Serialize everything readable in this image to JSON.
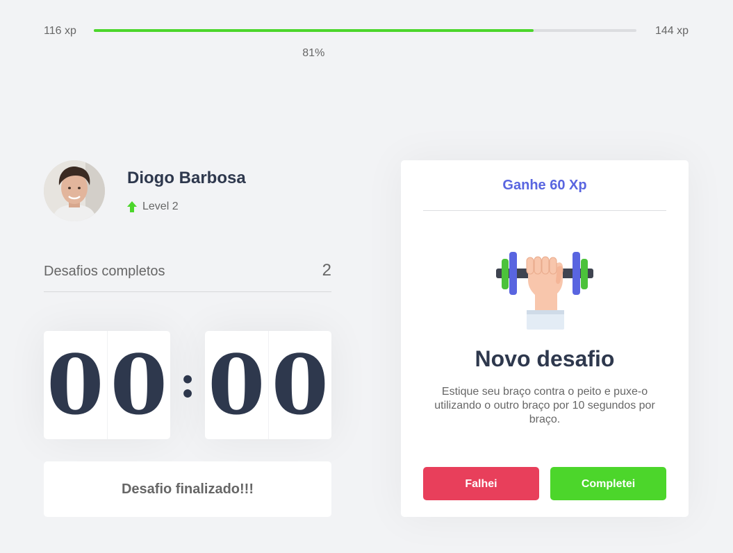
{
  "experience": {
    "min_label": "116 xp",
    "max_label": "144 xp",
    "progress_label": "81%",
    "progress": 0.81
  },
  "profile": {
    "name": "Diogo Barbosa",
    "level_label": "Level 2"
  },
  "completed": {
    "label": "Desafios completos",
    "count": "2"
  },
  "countdown": {
    "minute_left": "0",
    "minute_right": "0",
    "separator": ":",
    "second_left": "0",
    "second_right": "0"
  },
  "finished_label": "Desafio finalizado!!!",
  "challenge": {
    "reward": "Ganhe 60 Xp",
    "icon": "dumbbell-icon",
    "title": "Novo desafio",
    "description": "Estique seu braço contra o peito e puxe-o utilizando o outro braço por 10 segundos por braço.",
    "fail_label": "Falhei",
    "complete_label": "Completei"
  },
  "colors": {
    "accent_green": "#4cd62b",
    "accent_red": "#e83f5b",
    "accent_blue": "#5965e0",
    "title_dark": "#2e384d",
    "background": "#f2f3f5"
  }
}
